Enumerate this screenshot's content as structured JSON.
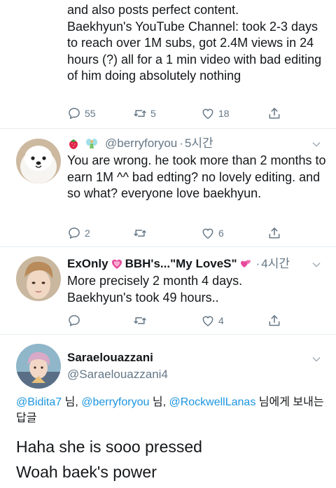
{
  "tweet1": {
    "text": "and also posts perfect content.\nBaekhyun's YouTube Channel: took 2-3 days to reach over 1M subs, got 2.4M views in 24 hours (?) all for a 1 min video with bad editing of him doing absolutely nothing",
    "replies": "55",
    "retweets": "5",
    "likes": "18"
  },
  "tweet2": {
    "handle": "@berryforyou",
    "sep": "·",
    "time": "5시간",
    "text": "You are wrong. he took more than 2 months to earn 1M ^^ bad edting? no lovely editing. and so what? everyone love baekhyun.",
    "replies": "2",
    "retweets": "",
    "likes": "6"
  },
  "tweet3": {
    "name_part1": "ExOnly",
    "name_part2": "BBH's...\"My LoveS\"",
    "sep": "·",
    "time": "4시간",
    "text": "More precisely 2 month 4 days.\nBaekhyun's took 49 hours..",
    "replies": "",
    "retweets": "",
    "likes": "4"
  },
  "tweet4": {
    "name": "Saraelouazzani",
    "handle": "@Saraelouazzani4",
    "reply_to": {
      "user1": "@Bidita7",
      "suffix1": " 님, ",
      "user2": "@berryforyou",
      "suffix2": " 님, ",
      "user3": "@RockwellLanas",
      "suffix3": " 님에게 보내는 답글"
    },
    "text": "Haha she is sooo pressed\nWoah baek's power"
  },
  "icons": {
    "reply": "reply-icon",
    "retweet": "retweet-icon",
    "like": "heart-icon",
    "share": "share-icon",
    "more": "chevron-down-icon"
  },
  "colors": {
    "text": "#14171a",
    "muted": "#657786",
    "link": "#1b95e0",
    "divider": "#e6ecf0",
    "heart_emoji": "#e84a9b"
  }
}
